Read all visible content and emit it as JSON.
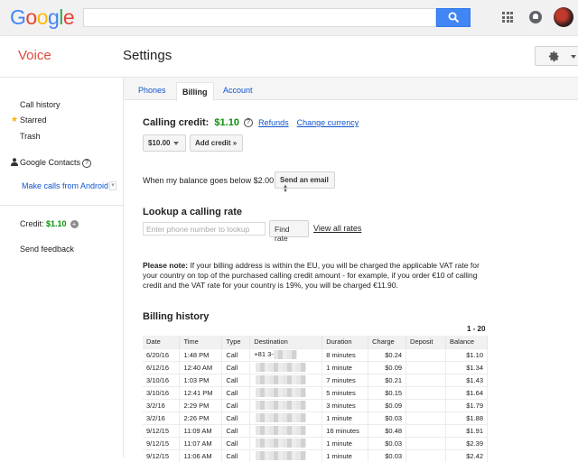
{
  "topbar": {
    "logo": [
      "G",
      "o",
      "o",
      "g",
      "l",
      "e"
    ],
    "search_value": ""
  },
  "header": {
    "app_name": "Voice",
    "page_title": "Settings"
  },
  "sidebar": {
    "call_history": "Call history",
    "starred": "Starred",
    "trash": "Trash",
    "google_contacts": "Google Contacts",
    "help_glyph": "?",
    "make_calls": "Make calls from Android",
    "credit_label": "Credit:",
    "credit_value": "$1.10",
    "send_feedback": "Send feedback"
  },
  "tabs": [
    "Phones",
    "Billing",
    "Account"
  ],
  "billing": {
    "calling_credit_label": "Calling credit:",
    "calling_credit_value": "$1.10",
    "refunds": "Refunds",
    "change_currency": "Change currency",
    "amount_select": "$10.00",
    "add_credit": "Add credit »",
    "balance_label": "When my balance goes below $2.00:",
    "balance_action": "Send an email",
    "lookup_title": "Lookup a calling rate",
    "lookup_placeholder": "Enter phone number to lookup",
    "find_rate": "Find rate",
    "view_all_rates": "View all rates",
    "note_bold": "Please note:",
    "note_text": " If your billing address is within the EU, you will be charged the applicable VAT rate for your country on top of the purchased calling credit amount - for example, if you order €10 of calling credit and the VAT rate for your country is 19%, you will be charged €11.90.",
    "history_title": "Billing history",
    "range": "1 - 20",
    "columns": [
      "Date",
      "Time",
      "Type",
      "Destination",
      "Duration",
      "Charge",
      "Deposit",
      "Balance"
    ],
    "rows": [
      {
        "date": "6/20/16",
        "time": "1:48 PM",
        "type": "Call",
        "destination": "+81 3-",
        "duration": "8 minutes",
        "charge": "$0.24",
        "deposit": "",
        "balance": "$1.10"
      },
      {
        "date": "6/12/16",
        "time": "12:40 AM",
        "type": "Call",
        "destination": "",
        "duration": "1 minute",
        "charge": "$0.09",
        "deposit": "",
        "balance": "$1.34"
      },
      {
        "date": "3/10/16",
        "time": "1:03 PM",
        "type": "Call",
        "destination": "",
        "duration": "7 minutes",
        "charge": "$0.21",
        "deposit": "",
        "balance": "$1.43"
      },
      {
        "date": "3/10/16",
        "time": "12:41 PM",
        "type": "Call",
        "destination": "",
        "duration": "5 minutes",
        "charge": "$0.15",
        "deposit": "",
        "balance": "$1.64"
      },
      {
        "date": "3/2/16",
        "time": "2:29 PM",
        "type": "Call",
        "destination": "",
        "duration": "3 minutes",
        "charge": "$0.09",
        "deposit": "",
        "balance": "$1.79"
      },
      {
        "date": "3/2/16",
        "time": "2:26 PM",
        "type": "Call",
        "destination": "",
        "duration": "1 minute",
        "charge": "$0.03",
        "deposit": "",
        "balance": "$1.88"
      },
      {
        "date": "9/12/15",
        "time": "11:09 AM",
        "type": "Call",
        "destination": "",
        "duration": "16 minutes",
        "charge": "$0.48",
        "deposit": "",
        "balance": "$1.91"
      },
      {
        "date": "9/12/15",
        "time": "11:07 AM",
        "type": "Call",
        "destination": "",
        "duration": "1 minute",
        "charge": "$0.03",
        "deposit": "",
        "balance": "$2.39"
      },
      {
        "date": "9/12/15",
        "time": "11:06 AM",
        "type": "Call",
        "destination": "",
        "duration": "1 minute",
        "charge": "$0.03",
        "deposit": "",
        "balance": "$2.42"
      }
    ]
  },
  "colors": {
    "brand_red": "#dd4b39",
    "link": "#1155cc",
    "credit_green": "#0a8f08",
    "search_blue": "#4285f4"
  }
}
